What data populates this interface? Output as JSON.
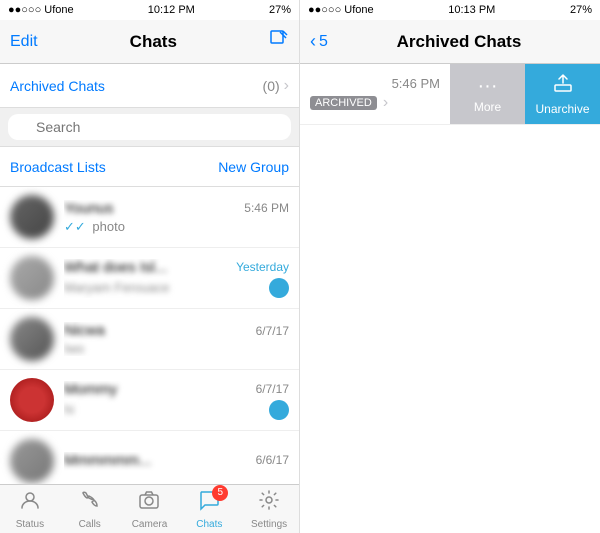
{
  "left": {
    "status_bar": {
      "carrier": "●●○○○ Ufone",
      "time": "10:12 PM",
      "battery_pct": "27%",
      "signal_icons": "▶ ↑ 27%▐"
    },
    "nav": {
      "edit": "Edit",
      "title": "Chats",
      "compose_icon": "✏"
    },
    "archived_row": {
      "label": "Archived Chats",
      "count": "(0)",
      "chevron": "›"
    },
    "search": {
      "placeholder": "Search"
    },
    "actions": {
      "broadcast": "Broadcast Lists",
      "new_group": "New Group"
    },
    "chats": [
      {
        "name": "Younus",
        "time": "5:46 PM",
        "preview": "photo",
        "ticks": "✓✓",
        "avatar_class": "avatar-1"
      },
      {
        "name": "What does Isl...",
        "time": "Yesterday",
        "preview": "Maryam Ferouace",
        "has_badge": true,
        "badge": "",
        "avatar_class": "avatar-2"
      },
      {
        "name": "Nicwa",
        "time": "6/7/17",
        "preview": "Iwo",
        "avatar_class": "avatar-3"
      },
      {
        "name": "Mommy",
        "time": "6/7/17",
        "preview": "hi",
        "has_badge": true,
        "badge": "",
        "avatar_class": "avatar-4"
      },
      {
        "name": "Mmmmmm...",
        "time": "6/6/17",
        "preview": "",
        "avatar_class": "avatar-5"
      }
    ],
    "tab_bar": {
      "items": [
        {
          "icon": "⬛",
          "label": "Status",
          "active": false
        },
        {
          "icon": "📞",
          "label": "Calls",
          "active": false
        },
        {
          "icon": "📷",
          "label": "Camera",
          "active": false
        },
        {
          "icon": "💬",
          "label": "Chats",
          "active": true,
          "badge": "5"
        },
        {
          "icon": "⚙",
          "label": "Settings",
          "active": false
        }
      ]
    }
  },
  "right": {
    "status_bar": {
      "carrier": "●●○○○ Ufone",
      "time": "10:13 PM",
      "battery_pct": "27%"
    },
    "nav": {
      "back_chevron": "‹",
      "back_count": "5",
      "title": "Archived Chats"
    },
    "archived_item": {
      "time": "5:46 PM",
      "archived_tag": "ARCHIVED",
      "chevron": "›"
    },
    "swipe_buttons": {
      "more_label": "More",
      "more_icon": "···",
      "unarchive_label": "Unarchive",
      "unarchive_icon": "⬆"
    }
  }
}
